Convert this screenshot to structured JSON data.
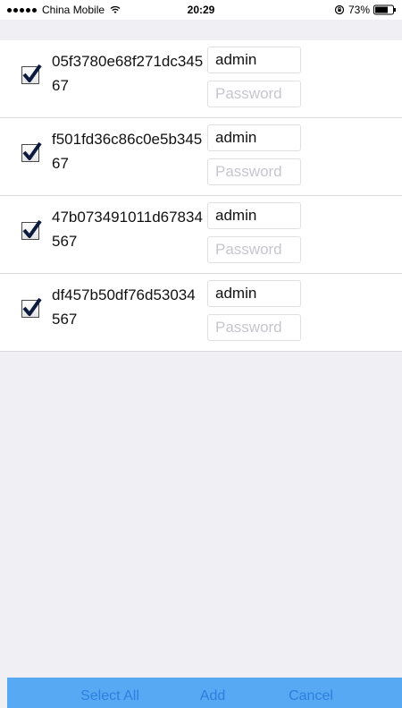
{
  "status_bar": {
    "carrier": "China Mobile",
    "time": "20:29",
    "battery": "73%"
  },
  "devices": [
    {
      "id": "05f3780e68f271dc34567",
      "username": "admin",
      "password_placeholder": "Password",
      "checked": true
    },
    {
      "id": "f501fd36c86c0e5b34567",
      "username": "admin",
      "password_placeholder": "Password",
      "checked": true
    },
    {
      "id": "47b073491011d67834567",
      "username": "admin",
      "password_placeholder": "Password",
      "checked": true
    },
    {
      "id": "df457b50df76d53034567",
      "username": "admin",
      "password_placeholder": "Password",
      "checked": true
    }
  ],
  "toolbar": {
    "select_all_label": "Select All",
    "add_label": "Add",
    "cancel_label": "Cancel"
  },
  "colors": {
    "toolbar_bg": "#58a9f4",
    "toolbar_text": "#2b7fde",
    "background": "#efeff4"
  },
  "icons": {
    "wifi": "wifi-icon",
    "lock": "orientation-lock-icon",
    "battery": "battery-icon",
    "checkbox": "checkmark-icon"
  }
}
